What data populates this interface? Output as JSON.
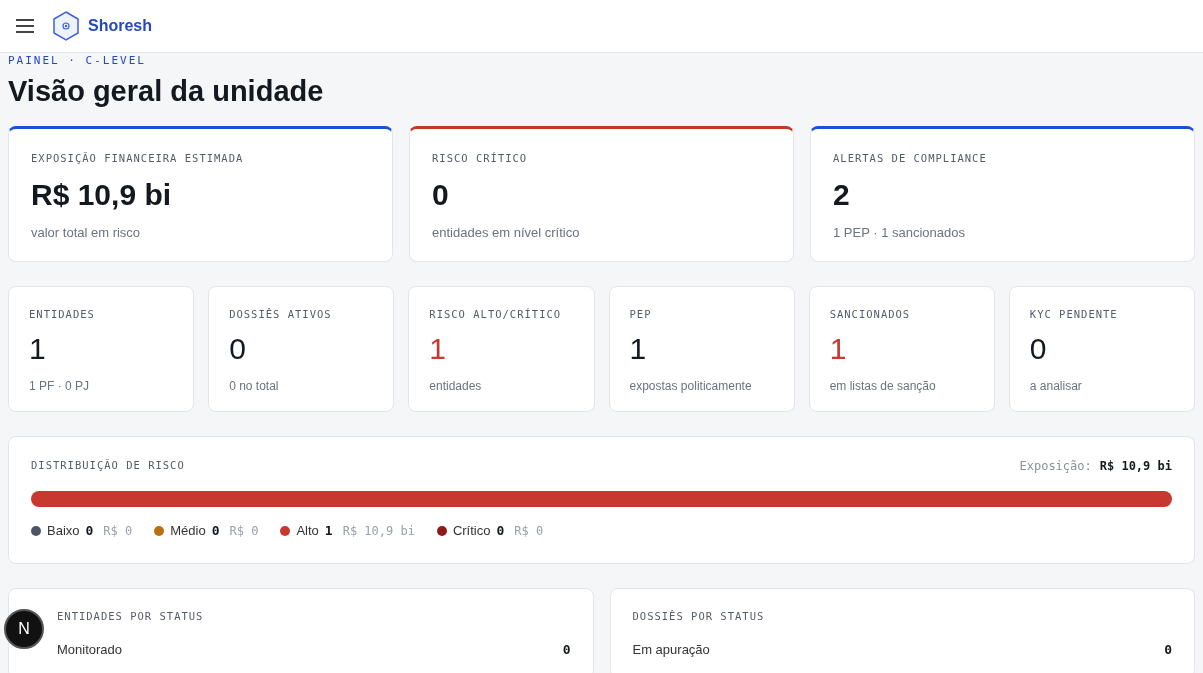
{
  "header": {
    "brand": "Shoresh"
  },
  "breadcrumb": "PAINEL · C-LEVEL",
  "title": "Visão geral da unidade",
  "top_cards": [
    {
      "label": "EXPOSIÇÃO FINANCEIRA ESTIMADA",
      "value": "R$ 10,9 bi",
      "caption": "valor total em risco",
      "color": "#1d4ed8"
    },
    {
      "label": "RISCO CRÍTICO",
      "value": "0",
      "caption": "entidades em nível crítico",
      "color": "#c0392b"
    },
    {
      "label": "ALERTAS DE COMPLIANCE",
      "value": "2",
      "caption": "1 PEP · 1 sancionados",
      "color": "#1d4ed8"
    }
  ],
  "stat_cards": [
    {
      "label": "ENTIDADES",
      "value": "1",
      "caption": "1 PF · 0 PJ",
      "alert": false
    },
    {
      "label": "DOSSIÊS ATIVOS",
      "value": "0",
      "caption": "0 no total",
      "alert": false
    },
    {
      "label": "RISCO ALTO/CRÍTICO",
      "value": "1",
      "caption": "entidades",
      "alert": true
    },
    {
      "label": "PEP",
      "value": "1",
      "caption": "expostas politicamente",
      "alert": false
    },
    {
      "label": "SANCIONADOS",
      "value": "1",
      "caption": "em listas de sanção",
      "alert": true
    },
    {
      "label": "KYC PENDENTE",
      "value": "0",
      "caption": "a analisar",
      "alert": false
    }
  ],
  "risk_distribution": {
    "title": "DISTRIBUIÇÃO DE RISCO",
    "exposure_label": "Exposição:",
    "exposure_value": "R$ 10,9 bi",
    "levels": [
      {
        "name": "Baixo",
        "count": "0",
        "amount": "R$ 0",
        "color": "#4b5563"
      },
      {
        "name": "Médio",
        "count": "0",
        "amount": "R$ 0",
        "color": "#b7700f"
      },
      {
        "name": "Alto",
        "count": "1",
        "amount": "R$ 10,9 bi",
        "color": "#c7382f"
      },
      {
        "name": "Crítico",
        "count": "0",
        "amount": "R$ 0",
        "color": "#8e1b1b"
      }
    ]
  },
  "status_panels": [
    {
      "title": "ENTIDADES POR STATUS",
      "rows": [
        {
          "label": "Monitorado",
          "count": "0"
        }
      ]
    },
    {
      "title": "DOSSIÊS POR STATUS",
      "rows": [
        {
          "label": "Em apuração",
          "count": "0"
        }
      ]
    }
  ],
  "badge": "N"
}
